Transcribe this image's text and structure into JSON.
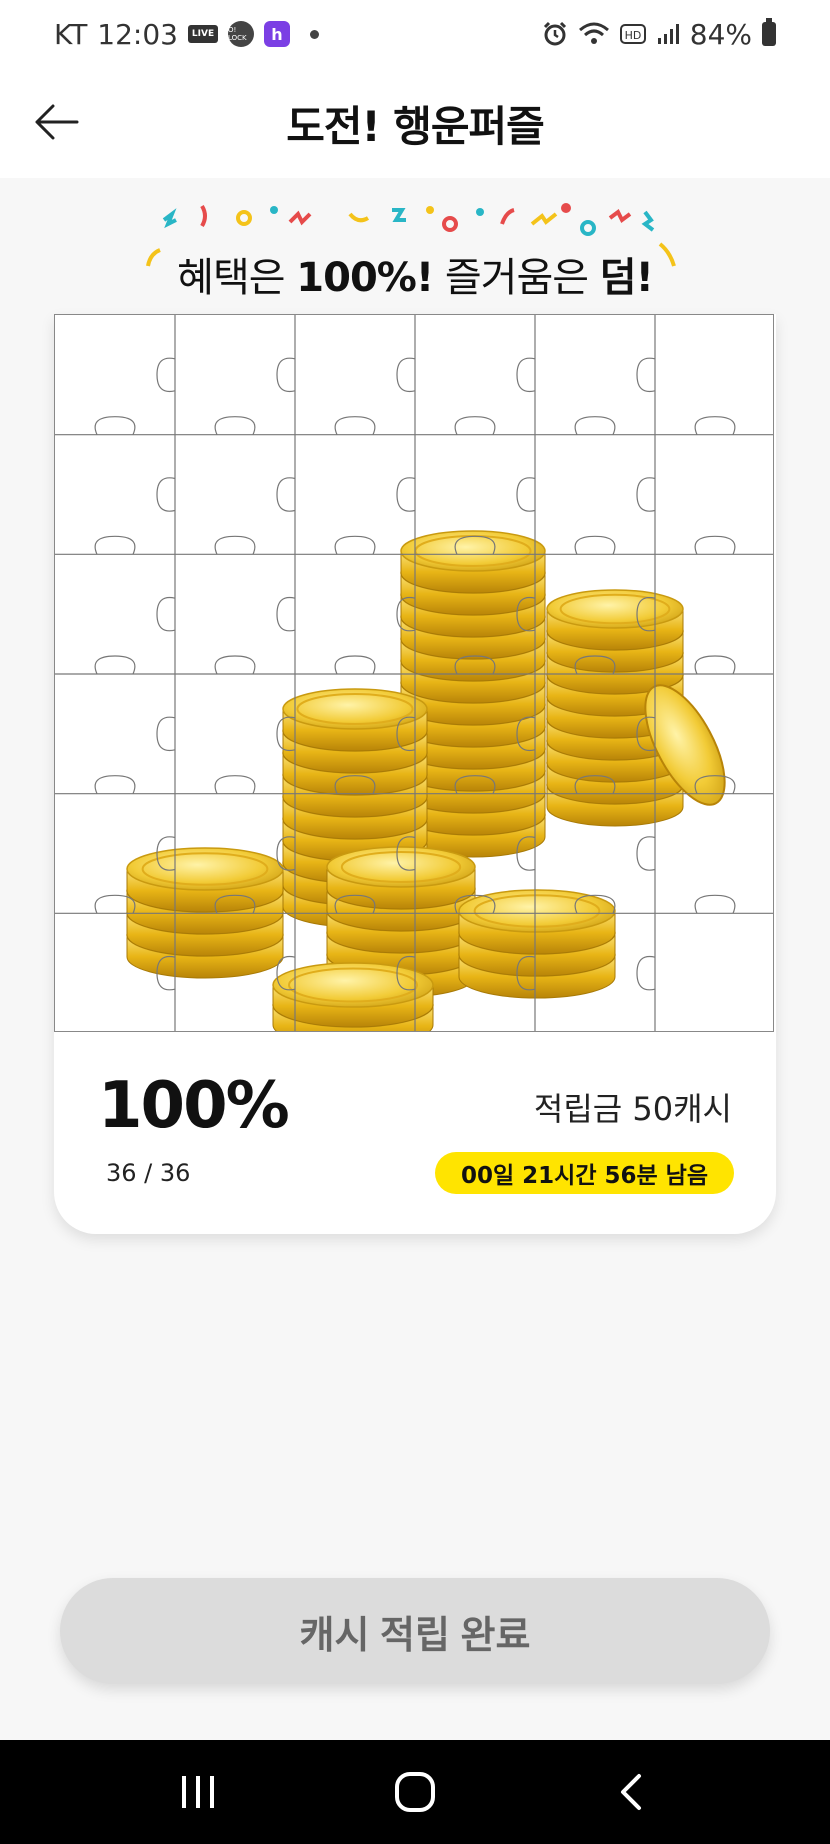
{
  "status_bar": {
    "carrier": "KT",
    "time": "12:03",
    "live_label": "LIVE",
    "lock_label": "O! LOCK",
    "h_label": "h",
    "battery": "84%"
  },
  "header": {
    "title": "도전! 행운퍼즐"
  },
  "banner": {
    "prefix": "혜택은 ",
    "highlight1": "100%!",
    "middle": " 즐거움은 ",
    "highlight2": "덤!"
  },
  "puzzle": {
    "grid_cols": 6,
    "grid_rows": 6,
    "percent": "100%",
    "pieces": "36 / 36",
    "reward": "적립금 50캐시",
    "time_left": "00일 21시간 56분 남음"
  },
  "cta": {
    "label": "캐시 적립 완료"
  },
  "colors": {
    "accent_yellow": "#ffe400",
    "coin_gold": "#e8b516",
    "coin_light": "#fbe27a"
  }
}
